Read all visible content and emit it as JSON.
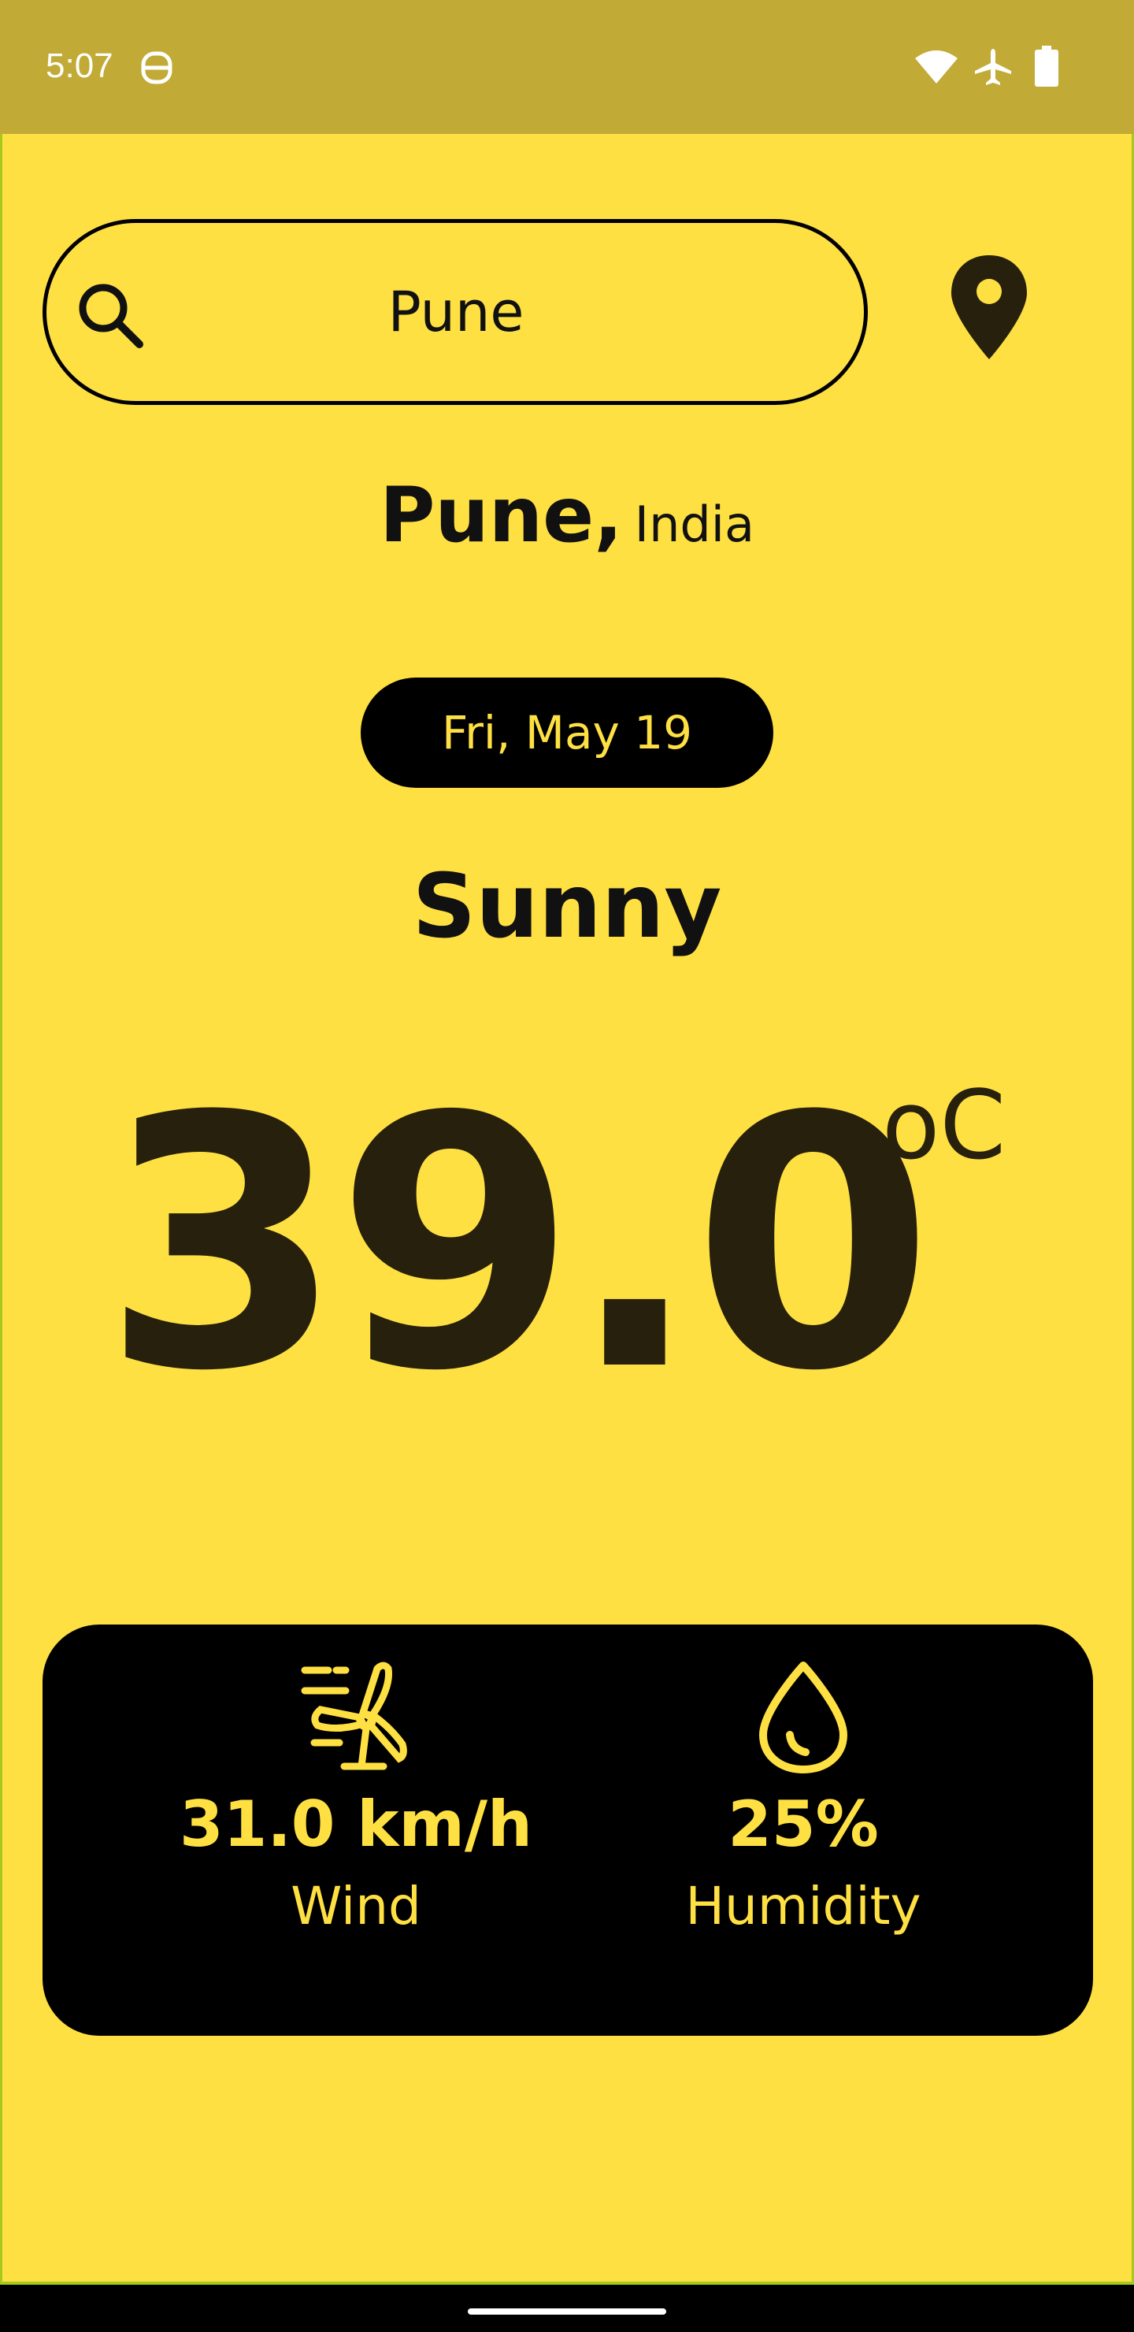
{
  "status_bar": {
    "time": "5:07"
  },
  "search": {
    "value": "Pune",
    "placeholder": "Search city"
  },
  "location": {
    "city": "Pune,",
    "country": "India"
  },
  "date": "Fri, May 19",
  "weather": {
    "condition": "Sunny",
    "temperature": "39.0",
    "unit": "oC"
  },
  "stats": {
    "wind": {
      "value": "31.0 km/h",
      "label": "Wind"
    },
    "humidity": {
      "value": "25%",
      "label": "Humidity"
    }
  },
  "colors": {
    "background": "#ffe043",
    "status_bar": "#c1aa36",
    "card": "#000000",
    "accent_text": "#ffe043",
    "primary_text": "#26200d"
  },
  "icons": [
    "search-icon",
    "location-pin-icon",
    "wind-turbine-icon",
    "water-drop-icon",
    "wifi-icon",
    "airplane-icon",
    "battery-icon"
  ]
}
